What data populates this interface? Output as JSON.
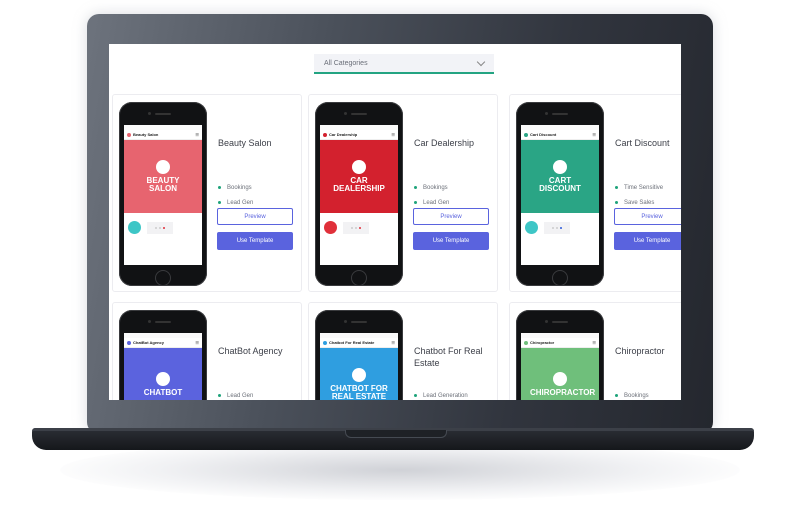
{
  "filter": {
    "selected": "All Categories"
  },
  "templates": [
    {
      "name": "Beauty Salon",
      "app_title": "Beauty Salon",
      "hero_text": "BEAUTY SALON",
      "hero_color": "#e7646f",
      "tags": [
        "Bookings",
        "Lead Gen"
      ],
      "preview": "Preview",
      "use": "Use Template",
      "avatar_color": "#3ec6c6",
      "active_dot": "#e0303a"
    },
    {
      "name": "Car Dealership",
      "app_title": "Car Dealership",
      "hero_text": "CAR DEALERSHIP",
      "hero_color": "#d3212e",
      "tags": [
        "Bookings",
        "Lead Gen"
      ],
      "preview": "Preview",
      "use": "Use Template",
      "avatar_color": "#e0303a",
      "active_dot": "#e0303a"
    },
    {
      "name": "Cart Discount",
      "app_title": "Cart Discount",
      "hero_text": "CART DISCOUNT",
      "hero_color": "#2aa585",
      "tags": [
        "Time Sensitive",
        "Save Sales"
      ],
      "preview": "Preview",
      "use": "Use Template",
      "avatar_color": "#3ec6c6",
      "active_dot": "#2d5bd8"
    },
    {
      "name": "ChatBot Agency",
      "app_title": "ChatBot Agency",
      "hero_text": "CHATBOT",
      "hero_color": "#5b63de",
      "tags": [
        "Lead Gen"
      ]
    },
    {
      "name": "Chatbot For Real Estate",
      "app_title": "Chatbot For Real Estate",
      "hero_text": "CHATBOT FOR REAL ESTATE",
      "hero_color": "#2f9ee0",
      "tags": [
        "Lead Generation"
      ]
    },
    {
      "name": "Chiropractor",
      "app_title": "Chiropractor",
      "hero_text": "CHIROPRACTOR",
      "hero_color": "#6fbf7b",
      "tags": [
        "Bookings"
      ]
    }
  ]
}
